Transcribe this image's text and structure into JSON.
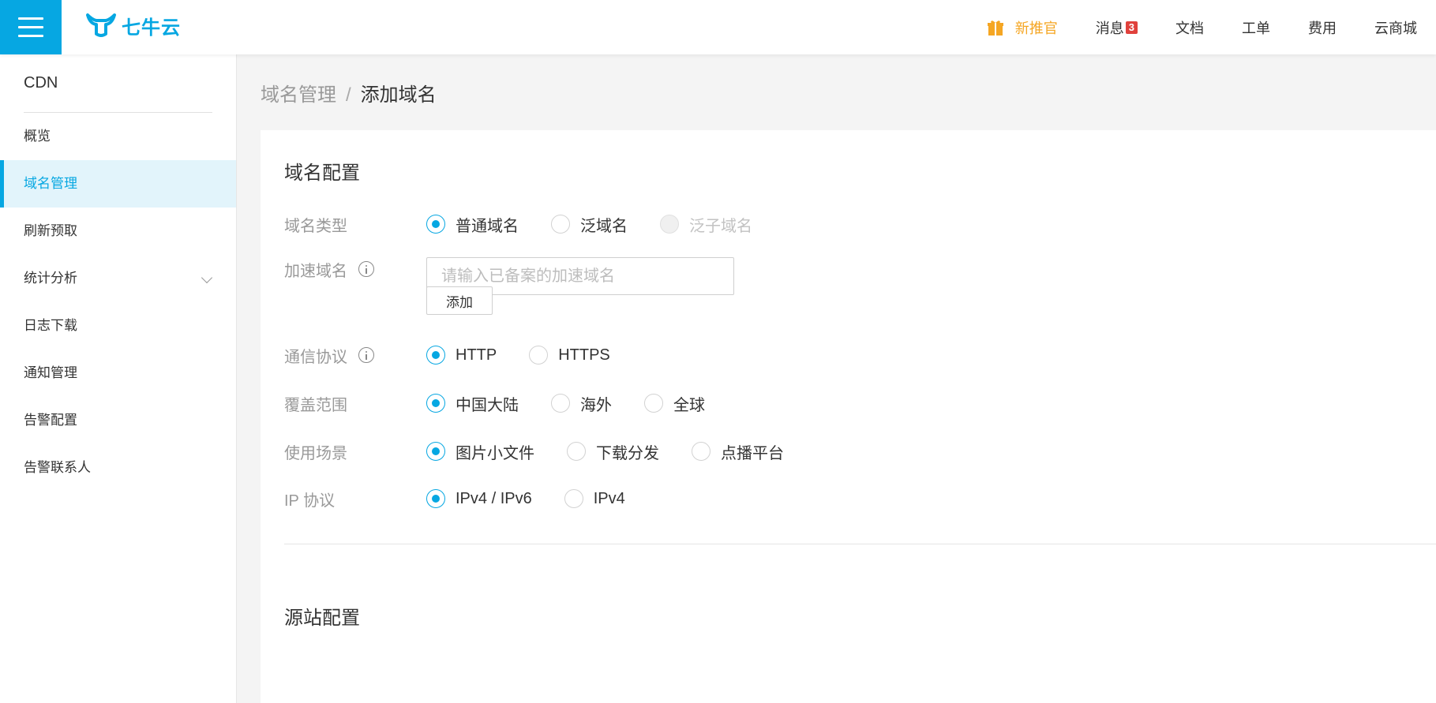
{
  "header": {
    "logo_text": "七牛云",
    "nav": {
      "promo": "新推官",
      "messages": "消息",
      "messages_count": "3",
      "docs": "文档",
      "tickets": "工单",
      "billing": "费用",
      "mall": "云商城"
    }
  },
  "sidebar": {
    "title": "CDN",
    "items": [
      {
        "label": "概览"
      },
      {
        "label": "域名管理"
      },
      {
        "label": "刷新预取"
      },
      {
        "label": "统计分析"
      },
      {
        "label": "日志下载"
      },
      {
        "label": "通知管理"
      },
      {
        "label": "告警配置"
      },
      {
        "label": "告警联系人"
      }
    ]
  },
  "breadcrumb": {
    "parent": "域名管理",
    "separator": "/",
    "current": "添加域名"
  },
  "form": {
    "section_title": "域名配置",
    "domain_type": {
      "label": "域名类型",
      "options": [
        "普通域名",
        "泛域名",
        "泛子域名"
      ],
      "selected": "普通域名"
    },
    "accel_domain": {
      "label": "加速域名",
      "placeholder": "请输入已备案的加速域名",
      "value": ""
    },
    "add_button": "添加",
    "protocol": {
      "label": "通信协议",
      "options": [
        "HTTP",
        "HTTPS"
      ],
      "selected": "HTTP"
    },
    "coverage": {
      "label": "覆盖范围",
      "options": [
        "中国大陆",
        "海外",
        "全球"
      ],
      "selected": "中国大陆"
    },
    "scenario": {
      "label": "使用场景",
      "options": [
        "图片小文件",
        "下载分发",
        "点播平台"
      ],
      "selected": "图片小文件"
    },
    "ip_protocol": {
      "label": "IP 协议",
      "options": [
        "IPv4 / IPv6",
        "IPv4"
      ],
      "selected": "IPv4 / IPv6"
    },
    "origin_section_title": "源站配置"
  },
  "colors": {
    "accent": "#06a7e2",
    "promo": "#f5a623",
    "badge": "#e0413c",
    "active_bg": "#e2f4fb"
  },
  "icons": {
    "menu": "hamburger-icon",
    "logo": "qiniu-bull-logo",
    "promo": "gift-icon",
    "info": "info-circle-icon",
    "expand": "chevron-down-icon"
  }
}
